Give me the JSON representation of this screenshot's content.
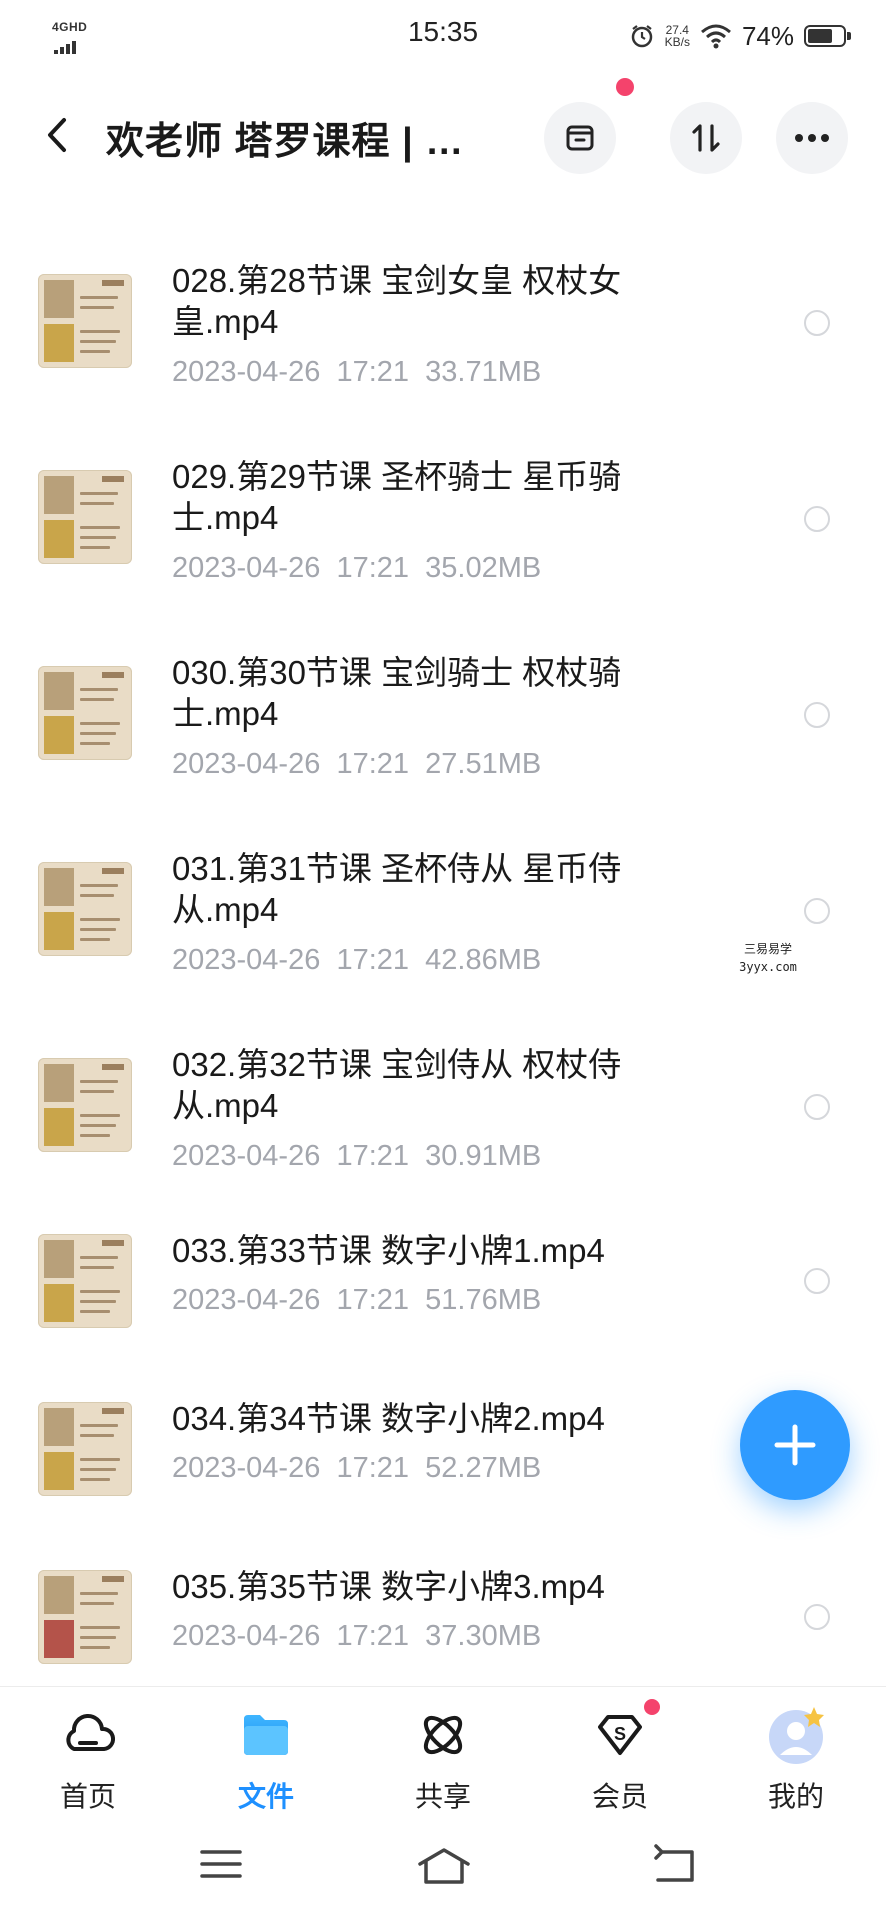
{
  "status_bar": {
    "network": "4GHD",
    "time": "15:35",
    "speed_value": "27.4",
    "speed_unit": "KB/s",
    "battery": "74%",
    "battery_level": 0.74
  },
  "header": {
    "title": "欢老师 塔罗课程 | …",
    "icons": [
      "back-arrow-icon",
      "archive-icon",
      "sort-icon",
      "more-icon"
    ]
  },
  "files": [
    {
      "name_line1": "028.第28节课 宝剑女皇 权杖女",
      "name_line2": "皇.mp4",
      "date": "2023-04-26",
      "time": "17:21",
      "size": "33.71MB"
    },
    {
      "name_line1": "029.第29节课 圣杯骑士 星币骑",
      "name_line2": "士.mp4",
      "date": "2023-04-26",
      "time": "17:21",
      "size": "35.02MB"
    },
    {
      "name_line1": "030.第30节课 宝剑骑士 权杖骑",
      "name_line2": "士.mp4",
      "date": "2023-04-26",
      "time": "17:21",
      "size": "27.51MB"
    },
    {
      "name_line1": "031.第31节课 圣杯侍从 星币侍",
      "name_line2": "从.mp4",
      "date": "2023-04-26",
      "time": "17:21",
      "size": "42.86MB"
    },
    {
      "name_line1": "032.第32节课 宝剑侍从 权杖侍",
      "name_line2": "从.mp4",
      "date": "2023-04-26",
      "time": "17:21",
      "size": "30.91MB"
    },
    {
      "name_line1": "033.第33节课 数字小牌1.mp4",
      "name_line2": "",
      "date": "2023-04-26",
      "time": "17:21",
      "size": "51.76MB"
    },
    {
      "name_line1": "034.第34节课 数字小牌2.mp4",
      "name_line2": "",
      "date": "2023-04-26",
      "time": "17:21",
      "size": "52.27MB"
    },
    {
      "name_line1": "035.第35节课 数字小牌3.mp4",
      "name_line2": "",
      "date": "2023-04-26",
      "time": "17:21",
      "size": "37.30MB"
    }
  ],
  "watermark": {
    "line1": "三易易学",
    "line2": "3yyx.com"
  },
  "tabs": [
    {
      "label": "首页",
      "icon": "home-cloud-icon",
      "active": false
    },
    {
      "label": "文件",
      "icon": "folder-icon",
      "active": true
    },
    {
      "label": "共享",
      "icon": "share-atom-icon",
      "active": false
    },
    {
      "label": "会员",
      "icon": "vip-badge-icon",
      "active": false
    },
    {
      "label": "我的",
      "icon": "avatar-icon",
      "active": false
    }
  ],
  "colors": {
    "accent": "#1e90ff",
    "badge": "#f4436c",
    "meta_text": "#a3a6ad"
  }
}
